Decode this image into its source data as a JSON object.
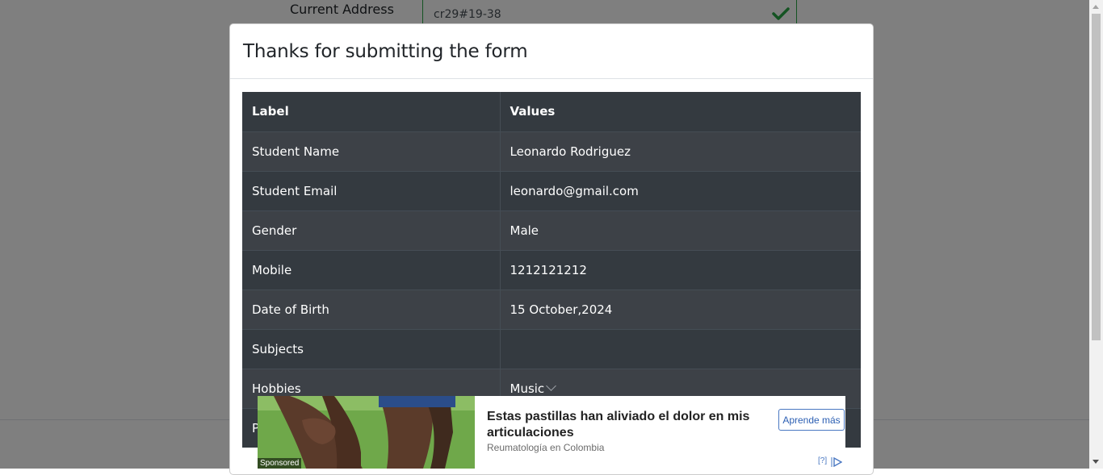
{
  "background_form": {
    "field_label": "Current Address",
    "field_value": "cr29#19-38",
    "valid_icon": "checkmark-icon",
    "valid_color": "#28a745"
  },
  "modal": {
    "title": "Thanks for submitting the form",
    "table": {
      "headers": [
        "Label",
        "Values"
      ],
      "rows": [
        {
          "label": "Student Name",
          "value": "Leonardo Rodriguez"
        },
        {
          "label": "Student Email",
          "value": "leonardo@gmail.com"
        },
        {
          "label": "Gender",
          "value": "Male"
        },
        {
          "label": "Mobile",
          "value": "1212121212"
        },
        {
          "label": "Date of Birth",
          "value": "15 October,2024"
        },
        {
          "label": "Subjects",
          "value": ""
        },
        {
          "label": "Hobbies",
          "value": "Music"
        },
        {
          "label": "P",
          "value": ""
        }
      ]
    }
  },
  "ad": {
    "headline": "Estas pastillas han aliviado el dolor en mis articulaciones",
    "source": "Reumatología en Colombia",
    "cta": "Aprende más",
    "sponsored": "Sponsored",
    "help": "[?]",
    "choice_icon": "adchoices-icon",
    "cta_color": "#2c5fb3"
  }
}
